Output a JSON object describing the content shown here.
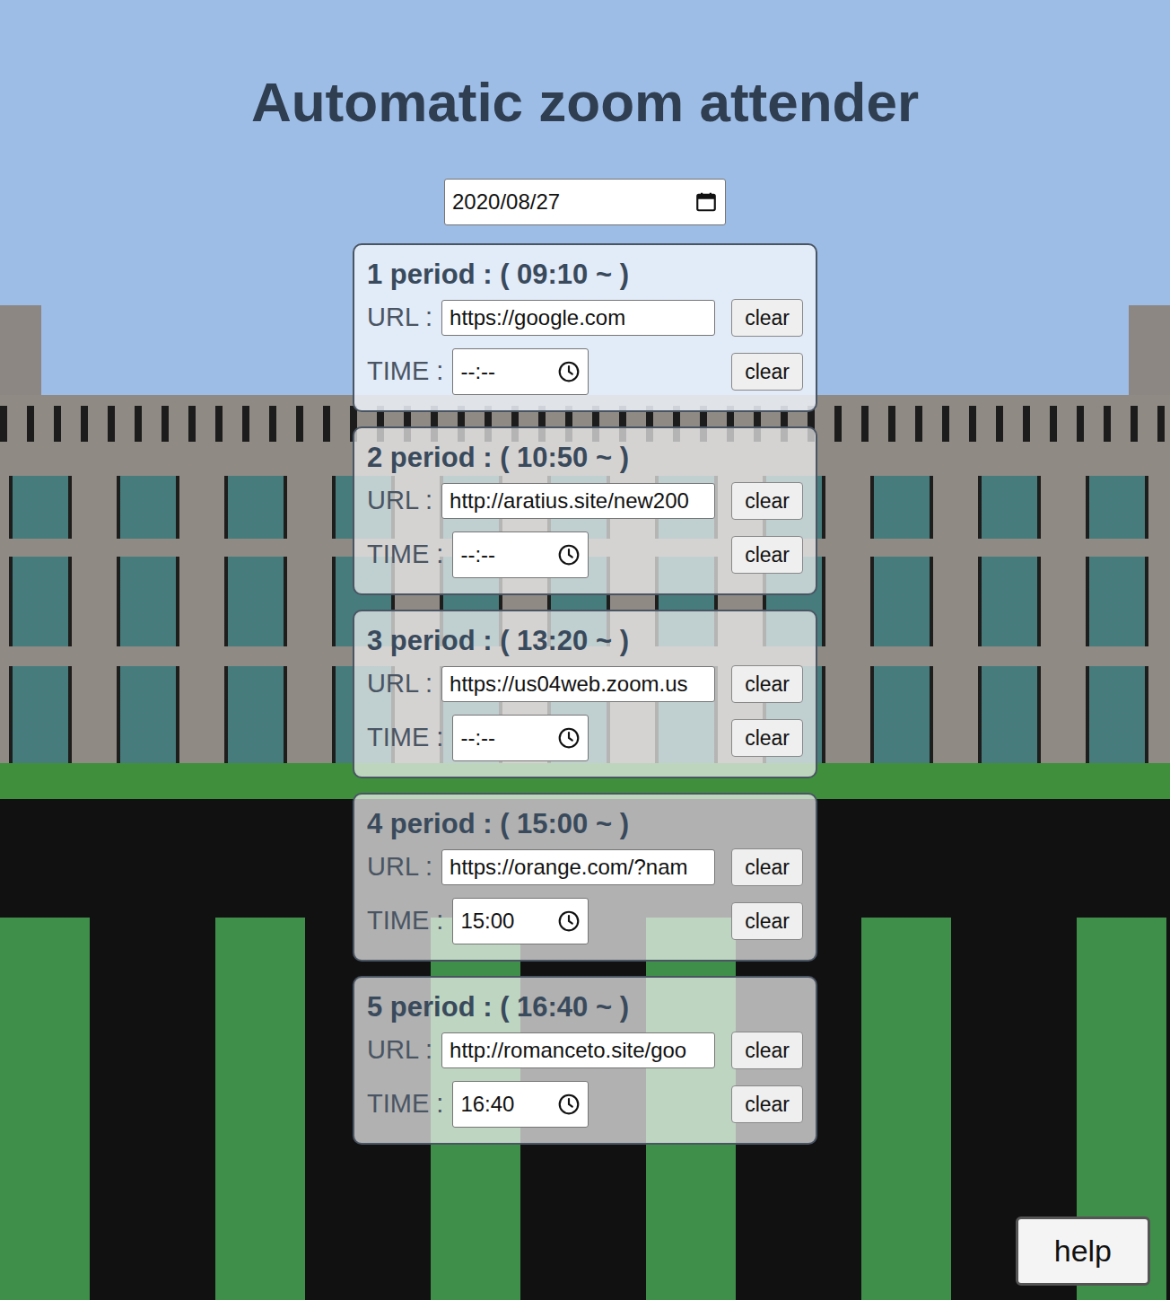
{
  "title": "Automatic zoom attender",
  "date": "2020/08/27",
  "periods": [
    {
      "label": "1 period : ( 09:10 ~ )",
      "url_label": "URL :",
      "url": "https://google.com",
      "url_clear": "clear",
      "time_label": "TIME :",
      "time": "--:--",
      "time_clear": "clear"
    },
    {
      "label": "2 period : ( 10:50 ~ )",
      "url_label": "URL :",
      "url": "http://aratius.site/new200",
      "url_clear": "clear",
      "time_label": "TIME :",
      "time": "--:--",
      "time_clear": "clear"
    },
    {
      "label": "3 period : ( 13:20 ~ )",
      "url_label": "URL :",
      "url": "https://us04web.zoom.us",
      "url_clear": "clear",
      "time_label": "TIME :",
      "time": "--:--",
      "time_clear": "clear"
    },
    {
      "label": "4 period : ( 15:00 ~ )",
      "url_label": "URL :",
      "url": "https://orange.com/?nam",
      "url_clear": "clear",
      "time_label": "TIME :",
      "time": "15:00",
      "time_clear": "clear"
    },
    {
      "label": "5 period : ( 16:40 ~ )",
      "url_label": "URL :",
      "url": "http://romanceto.site/goo",
      "url_clear": "clear",
      "time_label": "TIME :",
      "time": "16:40",
      "time_clear": "clear"
    }
  ],
  "help": "help"
}
